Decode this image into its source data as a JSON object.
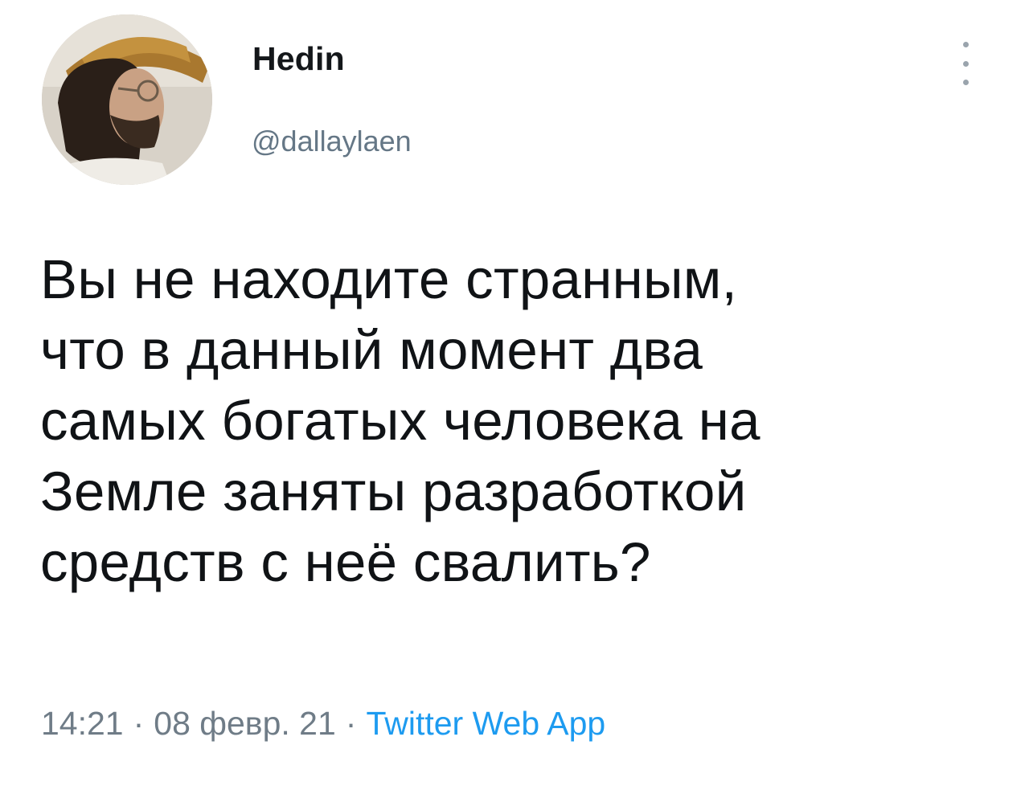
{
  "author": {
    "display_name": "Hedin",
    "handle": "@dallaylaen"
  },
  "tweet": {
    "text_lines": [
      "Вы не находите странным,",
      "что в данный момент два",
      "самых богатых человека на",
      "Земле заняты разработкой",
      "средств с неё свалить?"
    ],
    "time": "14:21",
    "separator": "·",
    "date": "08 февр. 21",
    "source": "Twitter Web App"
  },
  "icons": {
    "more": "more-vertical-icon"
  },
  "colors": {
    "text": "#14171a",
    "secondary": "#657786",
    "link": "#1d9bf0"
  }
}
